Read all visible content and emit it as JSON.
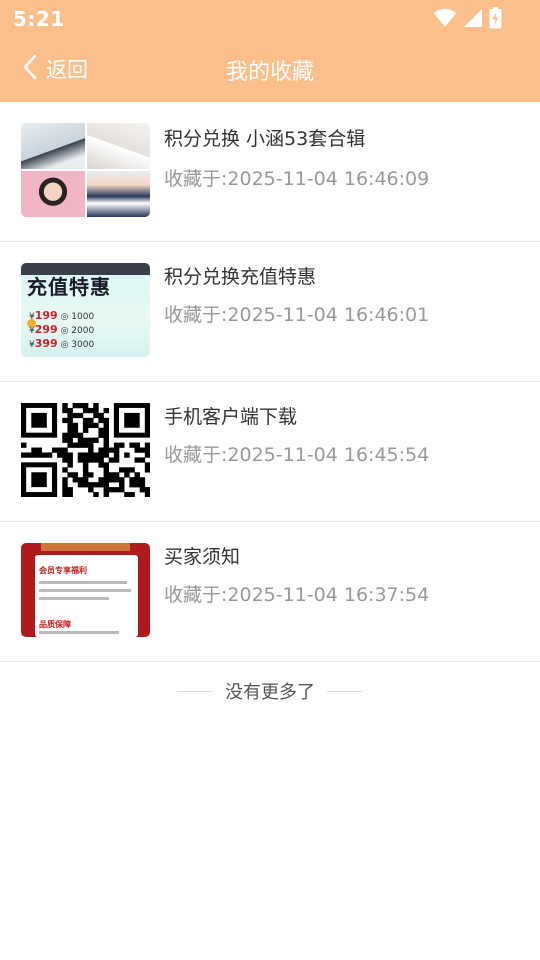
{
  "status_bar": {
    "time": "5:21",
    "icons": [
      "wifi-icon",
      "signal-icon",
      "battery-charging-icon"
    ]
  },
  "nav": {
    "back_label": "返回",
    "title": "我的收藏",
    "back_icon": "chevron-left-icon"
  },
  "colors": {
    "header_bg": "#fbbf8c",
    "title_text": "#333333",
    "meta_text": "#999999",
    "divider": "#ececec"
  },
  "favorites": [
    {
      "title": "积分兑换 小涵53套合辑",
      "time": "收藏于:2025-11-04 16:46:09",
      "thumb": "photo-grid-thumbnail"
    },
    {
      "title": "积分兑换充值特惠",
      "time": "收藏于:2025-11-04 16:46:01",
      "thumb": "recharge-promo-thumbnail"
    },
    {
      "title": "手机客户端下载",
      "time": "收藏于:2025-11-04 16:45:54",
      "thumb": "qr-code-thumbnail"
    },
    {
      "title": "买家须知",
      "time": "收藏于:2025-11-04 16:37:54",
      "thumb": "buyer-notice-thumbnail"
    }
  ],
  "thumb_text": {
    "promo_title": "充值特惠",
    "promo_rows": [
      {
        "price": "199",
        "points": "1000"
      },
      {
        "price": "299",
        "points": "2000"
      },
      {
        "price": "399",
        "points": "3000"
      }
    ],
    "notice_heading_1": "会员专享福利",
    "notice_heading_2": "品质保障"
  },
  "footer": {
    "end_text": "没有更多了"
  }
}
